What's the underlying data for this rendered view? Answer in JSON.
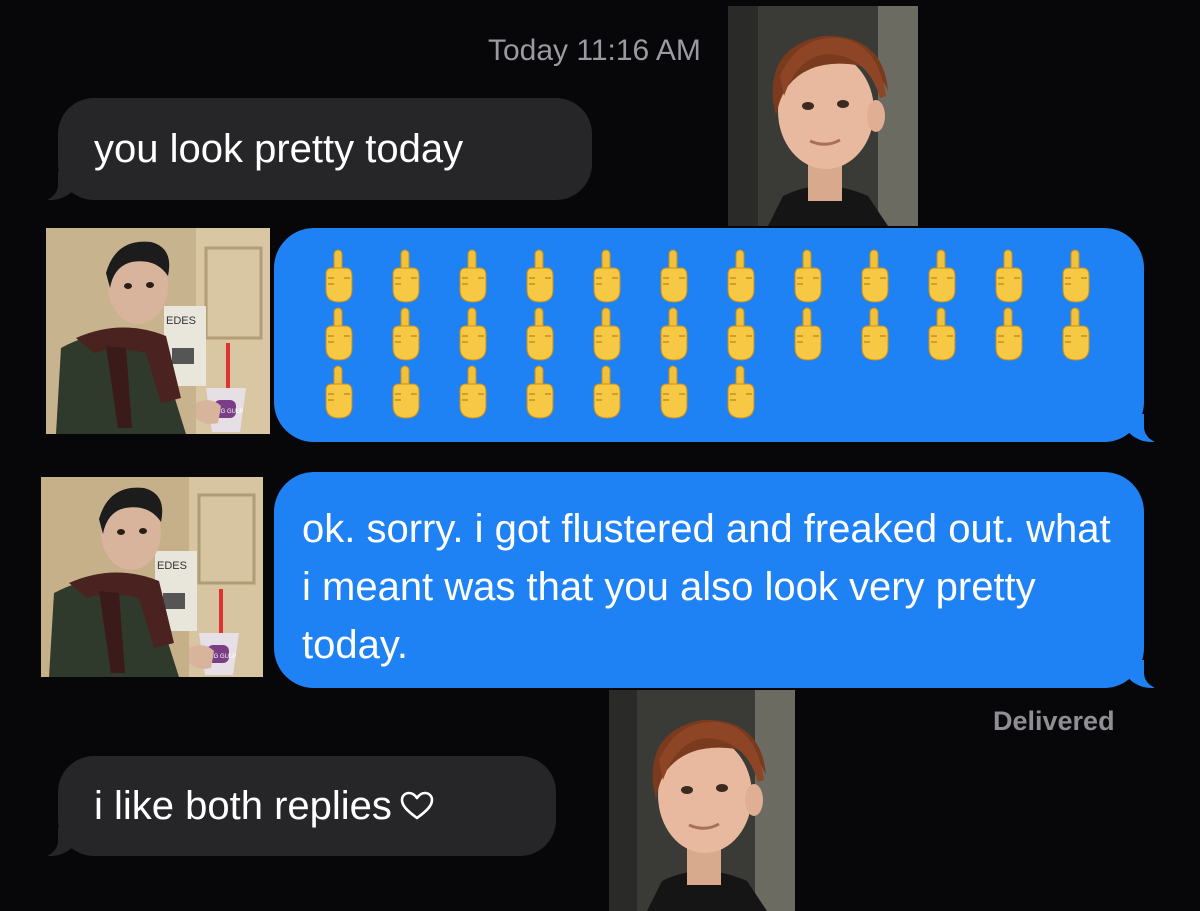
{
  "conversation": {
    "timestamp": "Today 11:16 AM",
    "messages": [
      {
        "sender": "them",
        "text": "you look pretty today"
      },
      {
        "sender": "me",
        "type": "emoji-grid",
        "emoji": "middle-finger-emoji",
        "rows": [
          12,
          12,
          7
        ]
      },
      {
        "sender": "me",
        "text": "ok. sorry. i got flustered and freaked out. what i meant was that you also look very pretty today."
      },
      {
        "sender": "them",
        "text": "i like both replies",
        "icon": "heart-outline-icon"
      }
    ],
    "delivered_label": "Delivered"
  },
  "photos": {
    "top": {
      "subject": "red-haired young man smiling"
    },
    "left_1": {
      "subject": "young man in scarf holding cup"
    },
    "left_2": {
      "subject": "young man in scarf holding cup"
    },
    "bottom": {
      "subject": "red-haired young man smiling"
    }
  },
  "cup_label": "BIG GULP",
  "poster_label": "EDES",
  "colors": {
    "background": "#07070a",
    "incoming_bubble": "#262629",
    "outgoing_bubble": "#1f82f4",
    "meta_text": "#9a9aa0"
  }
}
